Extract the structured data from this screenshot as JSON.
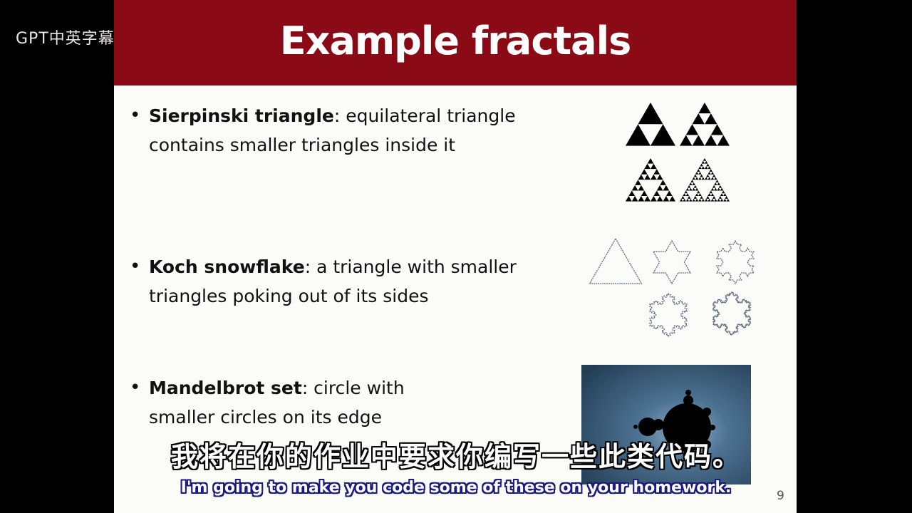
{
  "watermark": {
    "text": "GPT中英字幕课程",
    "logo": "bilibili"
  },
  "slide": {
    "title": "Example fractals",
    "page_number": "9",
    "bullets": [
      {
        "term": "Sierpinski triangle",
        "rest": ": equilateral triangle contains smaller triangles inside it"
      },
      {
        "term": "Koch snowflake",
        "rest": ": a triangle with smaller triangles poking out of its sides"
      },
      {
        "term": "Mandelbrot set",
        "rest": ": circle with smaller circles on its edge"
      }
    ]
  },
  "subtitles": {
    "zh": "我将在你的作业中要求你编写一些此类代码。",
    "en": "I'm going to make you code some of these on your homework."
  },
  "colors": {
    "title_bar": "#8a0a16",
    "slide_bg": "#fbfbf7",
    "snowflake": "#5a6a80",
    "mandel_bg": "#2e4a62"
  }
}
